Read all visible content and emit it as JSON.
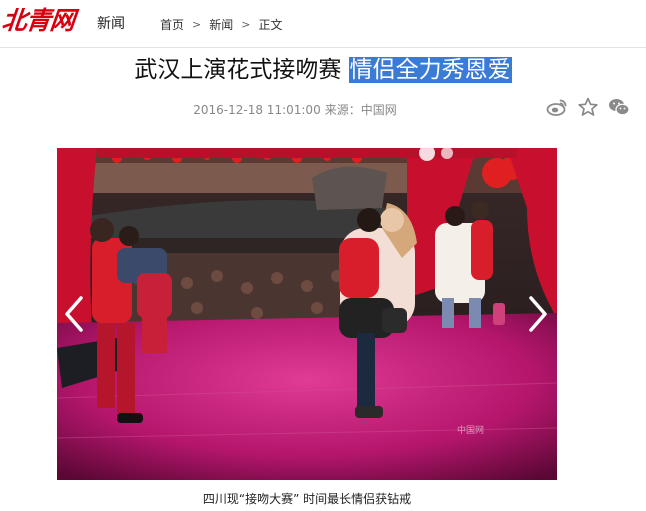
{
  "site": {
    "logo_text": "北青网",
    "channel": "新闻"
  },
  "breadcrumb": {
    "home": "首页",
    "section": "新闻",
    "current": "正文",
    "separator": ">"
  },
  "article": {
    "title_main": "武汉上演花式接吻赛",
    "title_highlight": "情侣全力秀恩爱",
    "date": "2016-12-18 11:01:00",
    "source_label": "来源：",
    "source": "中国网"
  },
  "share": {
    "icons": [
      "weibo-icon",
      "star-icon",
      "wechat-icon"
    ]
  },
  "gallery": {
    "caption": "四川现“接吻大赛”  时间最长情侣获钻戒",
    "watermark": "中国网"
  },
  "colors": {
    "brand": "#d7000f",
    "highlight": "#3a7bd5",
    "stage": "#c2176f"
  }
}
